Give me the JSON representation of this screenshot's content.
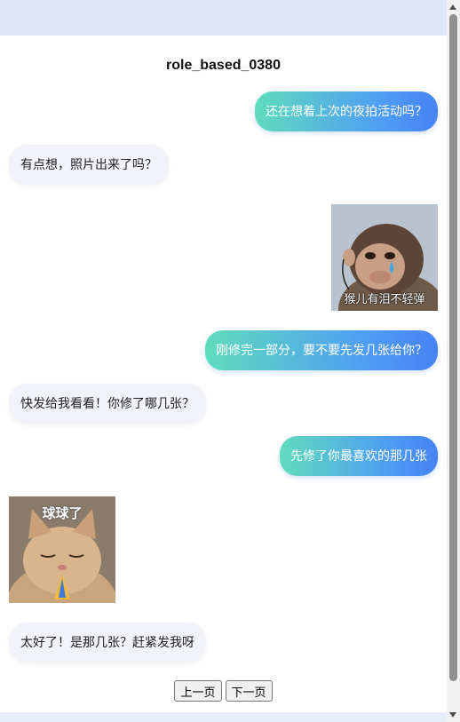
{
  "chat": {
    "title": "role_based_0380",
    "messages": [
      {
        "side": "sent",
        "text": "还在想着上次的夜拍活动吗？"
      },
      {
        "side": "recv",
        "text": "有点想，照片出来了吗？"
      },
      {
        "side": "sent",
        "sticker": "crying-monkey",
        "caption": "猴儿有泪不轻弹"
      },
      {
        "side": "sent",
        "text": "刚修完一部分，要不要先发几张给你？"
      },
      {
        "side": "recv",
        "text": "快发给我看看！你修了哪几张？"
      },
      {
        "side": "sent",
        "text": "先修了你最喜欢的那几张"
      },
      {
        "side": "recv",
        "sticker": "praying-cat",
        "caption": "球球了"
      },
      {
        "side": "recv",
        "text": "太好了！是那几张？赶紧发我呀"
      }
    ]
  },
  "pager": {
    "prev_label": "上一页",
    "next_label": "下一页"
  },
  "colors": {
    "sent_start": "#5fdcbc",
    "sent_end": "#4683f4",
    "recv_bg": "#f1f3f8"
  }
}
